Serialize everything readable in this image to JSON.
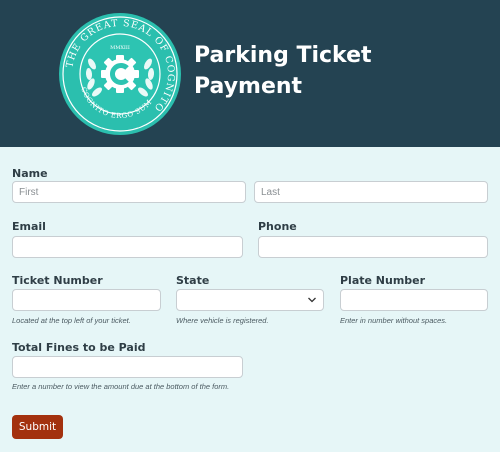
{
  "header": {
    "title_line1": "Parking Ticket",
    "title_line2": "Payment",
    "seal": {
      "ring_text": "THE GREAT SEAL OF COGNITO",
      "year": "MMXIII",
      "motto": "COGNITO ERGO SUM",
      "icon": "gear-c-seal-icon",
      "colors": {
        "ring": "#2bbfae",
        "inner": "#2dc4b2",
        "text": "#ffffff"
      }
    }
  },
  "form": {
    "name": {
      "label": "Name",
      "first_placeholder": "First",
      "last_placeholder": "Last",
      "first_value": "",
      "last_value": ""
    },
    "email": {
      "label": "Email",
      "value": ""
    },
    "phone": {
      "label": "Phone",
      "value": ""
    },
    "ticket_number": {
      "label": "Ticket Number",
      "value": "",
      "help": "Located at the top left of your ticket."
    },
    "state": {
      "label": "State",
      "selected": "",
      "help": "Where vehicle is registered.",
      "icon": "chevron-down-icon"
    },
    "plate_number": {
      "label": "Plate Number",
      "value": "",
      "help": "Enter in number without spaces."
    },
    "total_fines": {
      "label": "Total Fines to be Paid",
      "value": "",
      "help": "Enter a number to view the amount due at the bottom of the form."
    },
    "submit_label": "Submit"
  },
  "colors": {
    "header_bg": "#244352",
    "form_bg": "#e6f6f7",
    "submit_bg": "#a3310e",
    "label": "#2f3e46"
  }
}
